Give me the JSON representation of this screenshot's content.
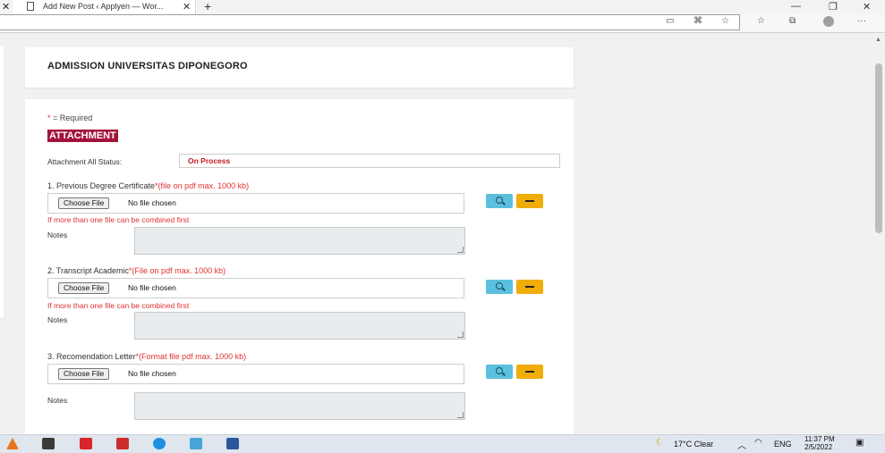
{
  "browser": {
    "tab_title": "Add New Post ‹ Applyen — Wor...",
    "close_glyph": "✕",
    "new_tab_glyph": "+"
  },
  "header": {
    "title": "ADMISSION UNIVERSITAS DIPONEGORO"
  },
  "form": {
    "required_star": "*",
    "required_text": " = Required",
    "section_title": "ATTACHMENT",
    "status_label": "Attachment All Status:",
    "status_value": "On Process",
    "choose_label": "Choose File",
    "no_file_text": "No file chosen",
    "notes_label": "Notes",
    "combine_note": "If more than one file can be combined first",
    "items": [
      {
        "label": "1. Previous Degree Certificate",
        "hint": "*(file on pdf max. 1000 kb)"
      },
      {
        "label": "2. Transcript Academic",
        "hint": "*(File on pdf max. 1000 kb)"
      },
      {
        "label": "3. Recomendation Letter",
        "hint": "*(Format file pdf max. 1000 kb)"
      }
    ]
  },
  "taskbar": {
    "weather": "17°C  Clear",
    "lang": "ENG",
    "time": "11:37 PM",
    "date": "2/5/2022"
  },
  "colors": {
    "accent_red": "#a3123a",
    "hint_red": "#e03131",
    "view_button": "#5bc0de",
    "remove_button": "#f0ad08"
  }
}
